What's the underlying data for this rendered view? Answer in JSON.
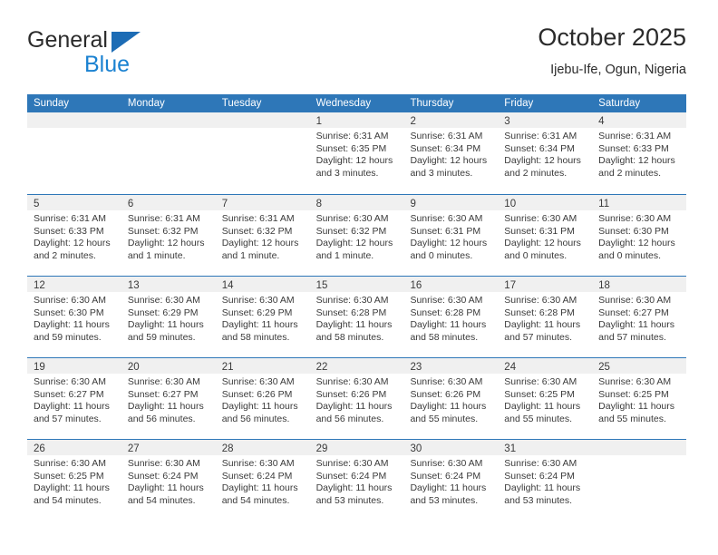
{
  "brand": {
    "line1": "General",
    "line2": "Blue",
    "triangle_color": "#1c6cb5",
    "blue_color": "#1b82d1"
  },
  "header": {
    "title": "October 2025",
    "subtitle": "Ijebu-Ife, Ogun, Nigeria"
  },
  "theme": {
    "header_blue": "#2e77b8",
    "band_gray": "#f0f0f0",
    "text": "#3a3a3a"
  },
  "weekdays": [
    "Sunday",
    "Monday",
    "Tuesday",
    "Wednesday",
    "Thursday",
    "Friday",
    "Saturday"
  ],
  "weeks": [
    [
      {
        "day": "",
        "sunrise": "",
        "sunset": "",
        "daylight_line1": "",
        "daylight_line2": ""
      },
      {
        "day": "",
        "sunrise": "",
        "sunset": "",
        "daylight_line1": "",
        "daylight_line2": ""
      },
      {
        "day": "",
        "sunrise": "",
        "sunset": "",
        "daylight_line1": "",
        "daylight_line2": ""
      },
      {
        "day": "1",
        "sunrise": "Sunrise: 6:31 AM",
        "sunset": "Sunset: 6:35 PM",
        "daylight_line1": "Daylight: 12 hours",
        "daylight_line2": "and 3 minutes."
      },
      {
        "day": "2",
        "sunrise": "Sunrise: 6:31 AM",
        "sunset": "Sunset: 6:34 PM",
        "daylight_line1": "Daylight: 12 hours",
        "daylight_line2": "and 3 minutes."
      },
      {
        "day": "3",
        "sunrise": "Sunrise: 6:31 AM",
        "sunset": "Sunset: 6:34 PM",
        "daylight_line1": "Daylight: 12 hours",
        "daylight_line2": "and 2 minutes."
      },
      {
        "day": "4",
        "sunrise": "Sunrise: 6:31 AM",
        "sunset": "Sunset: 6:33 PM",
        "daylight_line1": "Daylight: 12 hours",
        "daylight_line2": "and 2 minutes."
      }
    ],
    [
      {
        "day": "5",
        "sunrise": "Sunrise: 6:31 AM",
        "sunset": "Sunset: 6:33 PM",
        "daylight_line1": "Daylight: 12 hours",
        "daylight_line2": "and 2 minutes."
      },
      {
        "day": "6",
        "sunrise": "Sunrise: 6:31 AM",
        "sunset": "Sunset: 6:32 PM",
        "daylight_line1": "Daylight: 12 hours",
        "daylight_line2": "and 1 minute."
      },
      {
        "day": "7",
        "sunrise": "Sunrise: 6:31 AM",
        "sunset": "Sunset: 6:32 PM",
        "daylight_line1": "Daylight: 12 hours",
        "daylight_line2": "and 1 minute."
      },
      {
        "day": "8",
        "sunrise": "Sunrise: 6:30 AM",
        "sunset": "Sunset: 6:32 PM",
        "daylight_line1": "Daylight: 12 hours",
        "daylight_line2": "and 1 minute."
      },
      {
        "day": "9",
        "sunrise": "Sunrise: 6:30 AM",
        "sunset": "Sunset: 6:31 PM",
        "daylight_line1": "Daylight: 12 hours",
        "daylight_line2": "and 0 minutes."
      },
      {
        "day": "10",
        "sunrise": "Sunrise: 6:30 AM",
        "sunset": "Sunset: 6:31 PM",
        "daylight_line1": "Daylight: 12 hours",
        "daylight_line2": "and 0 minutes."
      },
      {
        "day": "11",
        "sunrise": "Sunrise: 6:30 AM",
        "sunset": "Sunset: 6:30 PM",
        "daylight_line1": "Daylight: 12 hours",
        "daylight_line2": "and 0 minutes."
      }
    ],
    [
      {
        "day": "12",
        "sunrise": "Sunrise: 6:30 AM",
        "sunset": "Sunset: 6:30 PM",
        "daylight_line1": "Daylight: 11 hours",
        "daylight_line2": "and 59 minutes."
      },
      {
        "day": "13",
        "sunrise": "Sunrise: 6:30 AM",
        "sunset": "Sunset: 6:29 PM",
        "daylight_line1": "Daylight: 11 hours",
        "daylight_line2": "and 59 minutes."
      },
      {
        "day": "14",
        "sunrise": "Sunrise: 6:30 AM",
        "sunset": "Sunset: 6:29 PM",
        "daylight_line1": "Daylight: 11 hours",
        "daylight_line2": "and 58 minutes."
      },
      {
        "day": "15",
        "sunrise": "Sunrise: 6:30 AM",
        "sunset": "Sunset: 6:28 PM",
        "daylight_line1": "Daylight: 11 hours",
        "daylight_line2": "and 58 minutes."
      },
      {
        "day": "16",
        "sunrise": "Sunrise: 6:30 AM",
        "sunset": "Sunset: 6:28 PM",
        "daylight_line1": "Daylight: 11 hours",
        "daylight_line2": "and 58 minutes."
      },
      {
        "day": "17",
        "sunrise": "Sunrise: 6:30 AM",
        "sunset": "Sunset: 6:28 PM",
        "daylight_line1": "Daylight: 11 hours",
        "daylight_line2": "and 57 minutes."
      },
      {
        "day": "18",
        "sunrise": "Sunrise: 6:30 AM",
        "sunset": "Sunset: 6:27 PM",
        "daylight_line1": "Daylight: 11 hours",
        "daylight_line2": "and 57 minutes."
      }
    ],
    [
      {
        "day": "19",
        "sunrise": "Sunrise: 6:30 AM",
        "sunset": "Sunset: 6:27 PM",
        "daylight_line1": "Daylight: 11 hours",
        "daylight_line2": "and 57 minutes."
      },
      {
        "day": "20",
        "sunrise": "Sunrise: 6:30 AM",
        "sunset": "Sunset: 6:27 PM",
        "daylight_line1": "Daylight: 11 hours",
        "daylight_line2": "and 56 minutes."
      },
      {
        "day": "21",
        "sunrise": "Sunrise: 6:30 AM",
        "sunset": "Sunset: 6:26 PM",
        "daylight_line1": "Daylight: 11 hours",
        "daylight_line2": "and 56 minutes."
      },
      {
        "day": "22",
        "sunrise": "Sunrise: 6:30 AM",
        "sunset": "Sunset: 6:26 PM",
        "daylight_line1": "Daylight: 11 hours",
        "daylight_line2": "and 56 minutes."
      },
      {
        "day": "23",
        "sunrise": "Sunrise: 6:30 AM",
        "sunset": "Sunset: 6:26 PM",
        "daylight_line1": "Daylight: 11 hours",
        "daylight_line2": "and 55 minutes."
      },
      {
        "day": "24",
        "sunrise": "Sunrise: 6:30 AM",
        "sunset": "Sunset: 6:25 PM",
        "daylight_line1": "Daylight: 11 hours",
        "daylight_line2": "and 55 minutes."
      },
      {
        "day": "25",
        "sunrise": "Sunrise: 6:30 AM",
        "sunset": "Sunset: 6:25 PM",
        "daylight_line1": "Daylight: 11 hours",
        "daylight_line2": "and 55 minutes."
      }
    ],
    [
      {
        "day": "26",
        "sunrise": "Sunrise: 6:30 AM",
        "sunset": "Sunset: 6:25 PM",
        "daylight_line1": "Daylight: 11 hours",
        "daylight_line2": "and 54 minutes."
      },
      {
        "day": "27",
        "sunrise": "Sunrise: 6:30 AM",
        "sunset": "Sunset: 6:24 PM",
        "daylight_line1": "Daylight: 11 hours",
        "daylight_line2": "and 54 minutes."
      },
      {
        "day": "28",
        "sunrise": "Sunrise: 6:30 AM",
        "sunset": "Sunset: 6:24 PM",
        "daylight_line1": "Daylight: 11 hours",
        "daylight_line2": "and 54 minutes."
      },
      {
        "day": "29",
        "sunrise": "Sunrise: 6:30 AM",
        "sunset": "Sunset: 6:24 PM",
        "daylight_line1": "Daylight: 11 hours",
        "daylight_line2": "and 53 minutes."
      },
      {
        "day": "30",
        "sunrise": "Sunrise: 6:30 AM",
        "sunset": "Sunset: 6:24 PM",
        "daylight_line1": "Daylight: 11 hours",
        "daylight_line2": "and 53 minutes."
      },
      {
        "day": "31",
        "sunrise": "Sunrise: 6:30 AM",
        "sunset": "Sunset: 6:24 PM",
        "daylight_line1": "Daylight: 11 hours",
        "daylight_line2": "and 53 minutes."
      },
      {
        "day": "",
        "sunrise": "",
        "sunset": "",
        "daylight_line1": "",
        "daylight_line2": ""
      }
    ]
  ]
}
